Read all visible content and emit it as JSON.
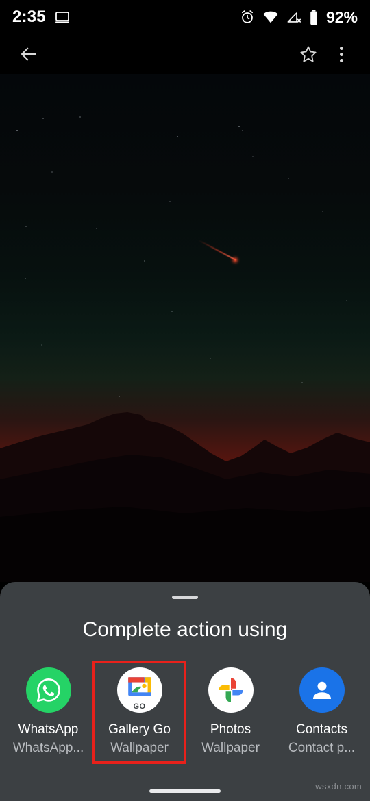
{
  "status_bar": {
    "time": "2:35",
    "battery_percent": "92%",
    "icons": [
      "cast-screen-icon",
      "alarm-icon",
      "wifi-icon",
      "cell-signal-off-icon",
      "battery-icon"
    ]
  },
  "toolbar": {
    "back_icon": "back-arrow-icon",
    "star_icon": "star-outline-icon",
    "overflow_icon": "more-vertical-icon"
  },
  "wallpaper": {
    "description": "night mountain landscape with red sunset glow, moon and meteor"
  },
  "sheet": {
    "title": "Complete action using",
    "handle": "drag-handle",
    "apps": [
      {
        "name": "WhatsApp",
        "subtitle": "WhatsApp...",
        "icon": "whatsapp-icon",
        "highlighted": false
      },
      {
        "name": "Gallery Go",
        "subtitle": "Wallpaper",
        "icon": "gallery-go-icon",
        "badge": "GO",
        "highlighted": true
      },
      {
        "name": "Photos",
        "subtitle": "Wallpaper",
        "icon": "google-photos-icon",
        "highlighted": false
      },
      {
        "name": "Contacts",
        "subtitle": "Contact p...",
        "icon": "contacts-icon",
        "highlighted": false
      }
    ]
  },
  "watermark": "wsxdn.com",
  "colors": {
    "sheet_background": "#3c4043",
    "highlight": "#e8211b",
    "whatsapp_green": "#25d366",
    "contacts_blue": "#1a73e8",
    "primary_text": "#ffffff",
    "secondary_text": "#b9bcc0"
  }
}
